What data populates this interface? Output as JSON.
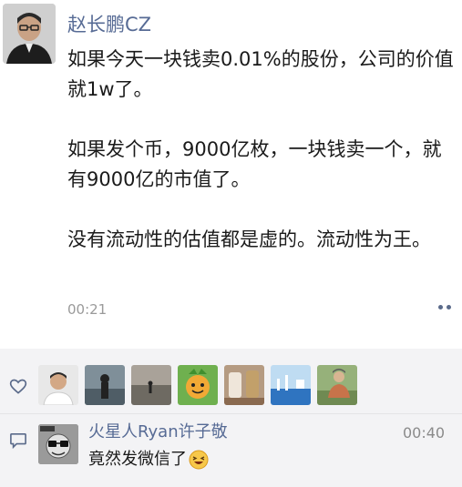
{
  "post": {
    "author_name": "赵长鹏CZ",
    "paragraphs": [
      "如果今天一块钱卖0.01%的股份，公司的价值就1w了。",
      "如果发个币，9000亿枚，一块钱卖一个，就有9000亿的市值了。",
      "没有流动性的估值都是虚的。流动性为王。"
    ],
    "timestamp": "00:21",
    "more_icon": "more-dots-icon"
  },
  "interactions": {
    "like_icon": "heart-outline-icon",
    "comment_icon": "comment-bubble-icon",
    "like_count": 7,
    "comment": {
      "author": "火星人Ryan许子敬",
      "time": "00:40",
      "text": "竟然发微信了",
      "emoji": "grinning-squint-emoji"
    }
  },
  "colors": {
    "name_link": "#576b95",
    "panel_bg": "#f3f3f5",
    "text": "#1a1a1a",
    "meta": "#9a9a9a"
  }
}
